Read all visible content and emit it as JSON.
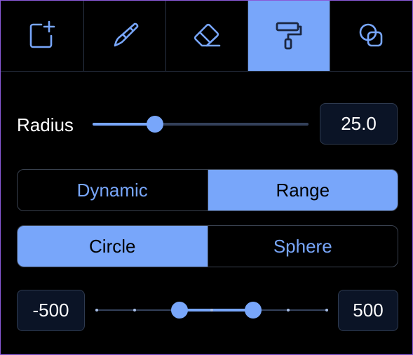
{
  "colors": {
    "accent": "#78a6fa",
    "background": "#000000",
    "panel_border": "#8a5ad8",
    "field_bg": "#0b1426"
  },
  "toolbar": {
    "tools": [
      {
        "icon": "add-layer-icon",
        "active": false
      },
      {
        "icon": "brush-icon",
        "active": false
      },
      {
        "icon": "eraser-icon",
        "active": false
      },
      {
        "icon": "paint-roller-icon",
        "active": true
      },
      {
        "icon": "overlap-circles-icon",
        "active": false
      }
    ]
  },
  "radius": {
    "label": "Radius",
    "value": "25.0",
    "slider_fraction": 0.29
  },
  "mode": {
    "options": [
      "Dynamic",
      "Range"
    ],
    "selected": "Range"
  },
  "shape": {
    "options": [
      "Circle",
      "Sphere"
    ],
    "selected": "Circle"
  },
  "range": {
    "min": "-500",
    "max": "500",
    "lower_fraction": 0.36,
    "upper_fraction": 0.68
  }
}
